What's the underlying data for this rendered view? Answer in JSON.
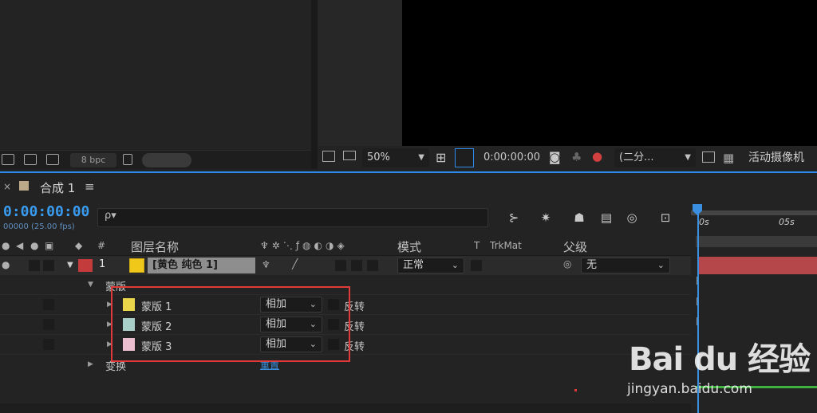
{
  "project": {
    "bpc_label": "8 bpc"
  },
  "viewer": {
    "zoom": "50%",
    "time": "0:00:00:00",
    "resolution": "(二分...",
    "camera": "活动摄像机"
  },
  "comp": {
    "close": "×",
    "name": "合成 1",
    "menu": "≡"
  },
  "timeline": {
    "timecode": "0:00:00:00",
    "fps": "00000 (25.00 fps)",
    "search_glyph": "ρ▾",
    "ruler_ticks": [
      "0s",
      "05s"
    ]
  },
  "columns": {
    "hash": "#",
    "layer_name": "图层名称",
    "mode": "模式",
    "t": "T",
    "trkmat": "TrkMat",
    "parent": "父级"
  },
  "layer": {
    "number": "1",
    "name": "[黄色 纯色 1]",
    "mode": "正常",
    "parent": "无",
    "color": "#c43b3b",
    "swatch": "#f0c81a"
  },
  "mask_group": {
    "label": "蒙版"
  },
  "masks": [
    {
      "name": "蒙版 1",
      "mode": "相加",
      "invert": "反转",
      "color": "#e9d64a"
    },
    {
      "name": "蒙版 2",
      "mode": "相加",
      "invert": "反转",
      "color": "#a9cfc9"
    },
    {
      "name": "蒙版 3",
      "mode": "相加",
      "invert": "反转",
      "color": "#ebbfcf"
    }
  ],
  "transform": {
    "label": "变换",
    "reset": "重置"
  },
  "watermark": {
    "logo": "Bai du 经验",
    "url": "jingyan.baidu.com"
  },
  "colors": {
    "accent": "#2d8ceb",
    "highlight": "#e03a3a",
    "layer_bar": "#b5464a"
  }
}
